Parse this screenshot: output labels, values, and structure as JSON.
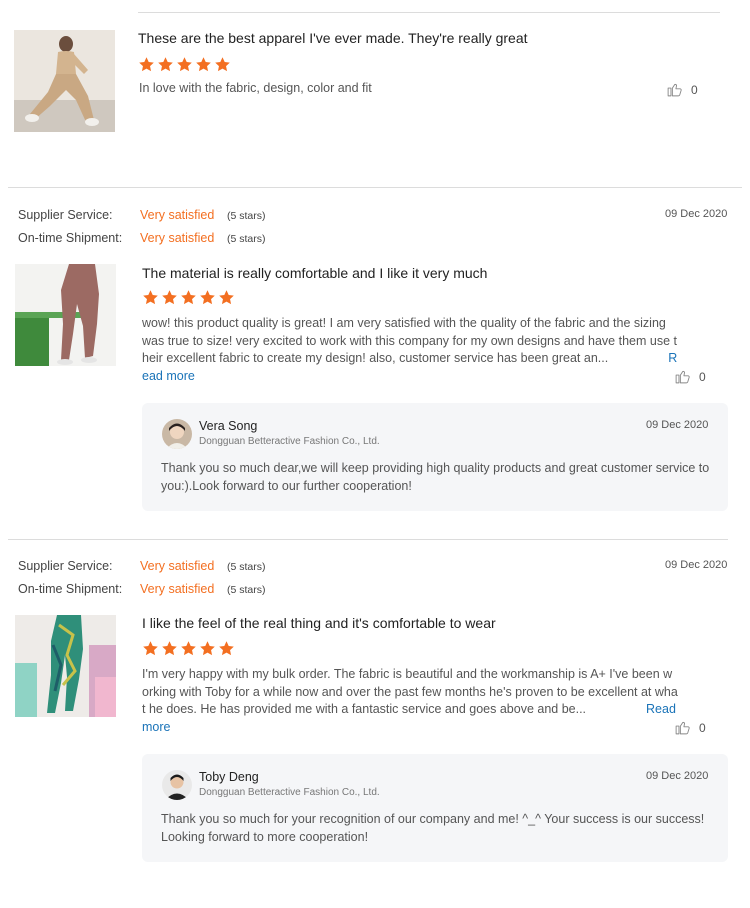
{
  "colors": {
    "accent": "#f36f21",
    "link": "#1a73b8",
    "reply_bg": "#f5f6f8"
  },
  "reviews": [
    {
      "title": "These are the best apparel I've ever made. They're really great",
      "rating": 5,
      "text": "In love with the fabric, design,  color and fit",
      "likes": "0",
      "thumb_icon": "beige-sportswear-photo"
    },
    {
      "supplier_label": "Supplier Service:",
      "supplier_value": "Very satisfied",
      "supplier_stars": "(5 stars)",
      "shipment_label": "On-time Shipment:",
      "shipment_value": "Very satisfied",
      "shipment_stars": "(5 stars)",
      "date": "09 Dec 2020",
      "title": "The material is really comfortable and I like it very much",
      "rating": 5,
      "text": "wow! this product quality is great! I am very satisfied with the quality of the fabric and the sizing was true to size! very excited to work with this company for my own designs and have them use their excellent fabric to create my design! also, customer service has been great an...",
      "read_more": "Read more",
      "likes": "0",
      "reply": {
        "name": "Vera Song",
        "company": "Dongguan Betteractive Fashion Co., Ltd.",
        "date": "09 Dec 2020",
        "text": "Thank you so much dear,we will keep providing high quality products and great customer service to you:).Look forward to our further cooperation!"
      }
    },
    {
      "supplier_label": "Supplier Service:",
      "supplier_value": "Very satisfied",
      "supplier_stars": "(5 stars)",
      "shipment_label": "On-time Shipment:",
      "shipment_value": "Very satisfied",
      "shipment_stars": "(5 stars)",
      "date": "09 Dec 2020",
      "title": "I like the feel of the real thing and it's comfortable to wear",
      "rating": 5,
      "text": "I'm very happy with my bulk order. The fabric is beautiful and the workmanship is A+ I've been working with Toby for a while now and over the past few months he's proven to be excellent at what he does. He has provided me with a fantastic service and goes above and be...",
      "read_more": "Read more",
      "likes": "0",
      "reply": {
        "name": "Toby Deng",
        "company": "Dongguan Betteractive Fashion Co., Ltd.",
        "date": "09 Dec 2020",
        "text": "Thank you so much for your recognition of our company and me!  ^_^ Your success is our success! Looking forward to more cooperation!"
      }
    }
  ]
}
